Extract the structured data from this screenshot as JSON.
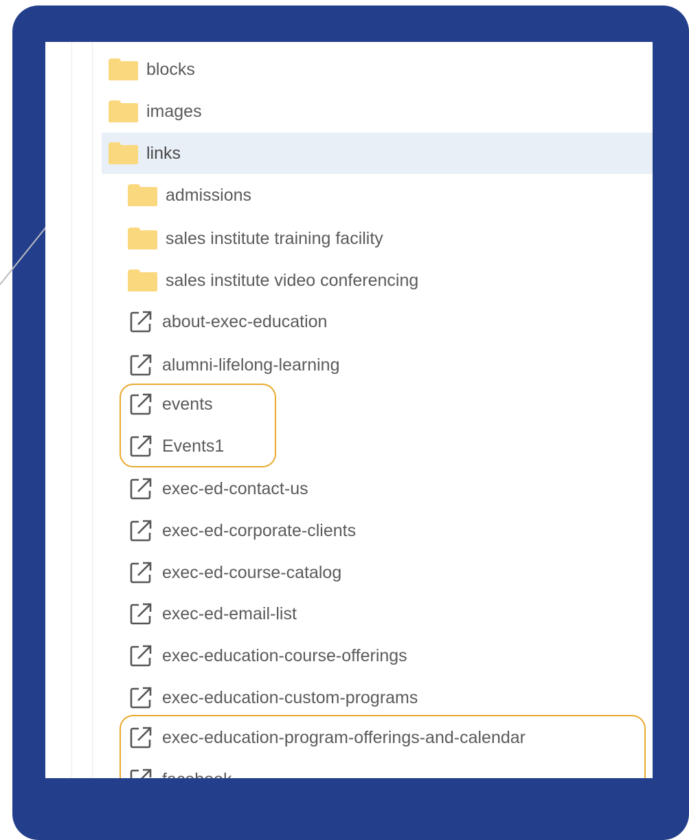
{
  "colors": {
    "frame": "#233f8b",
    "folder": "#fad87e",
    "highlight": "#e9a92c",
    "selected_row": "#e8eff6"
  },
  "tree": {
    "folders": [
      {
        "label": "blocks",
        "icon": "folder-icon"
      },
      {
        "label": "images",
        "icon": "folder-icon"
      },
      {
        "label": "links",
        "icon": "folder-icon",
        "selected": true
      }
    ],
    "links_children": {
      "folders": [
        {
          "label": "admissions",
          "icon": "folder-icon"
        },
        {
          "label": "sales institute training facility",
          "icon": "folder-icon"
        },
        {
          "label": "sales institute video conferencing",
          "icon": "folder-icon"
        }
      ],
      "links": [
        {
          "label": "about-exec-education",
          "icon": "external-link-icon"
        },
        {
          "label": "alumni-lifelong-learning",
          "icon": "external-link-icon"
        },
        {
          "label": "events",
          "icon": "external-link-icon"
        },
        {
          "label": "Events1",
          "icon": "external-link-icon"
        },
        {
          "label": "exec-ed-contact-us",
          "icon": "external-link-icon"
        },
        {
          "label": "exec-ed-corporate-clients",
          "icon": "external-link-icon"
        },
        {
          "label": "exec-ed-course-catalog",
          "icon": "external-link-icon"
        },
        {
          "label": "exec-ed-email-list",
          "icon": "external-link-icon"
        },
        {
          "label": "exec-education-course-offerings",
          "icon": "external-link-icon"
        },
        {
          "label": "exec-education-custom-programs",
          "icon": "external-link-icon"
        },
        {
          "label": "exec-education-program-offerings-and-calendar",
          "icon": "external-link-icon"
        },
        {
          "label": "facebook",
          "icon": "external-link-icon"
        }
      ]
    }
  }
}
